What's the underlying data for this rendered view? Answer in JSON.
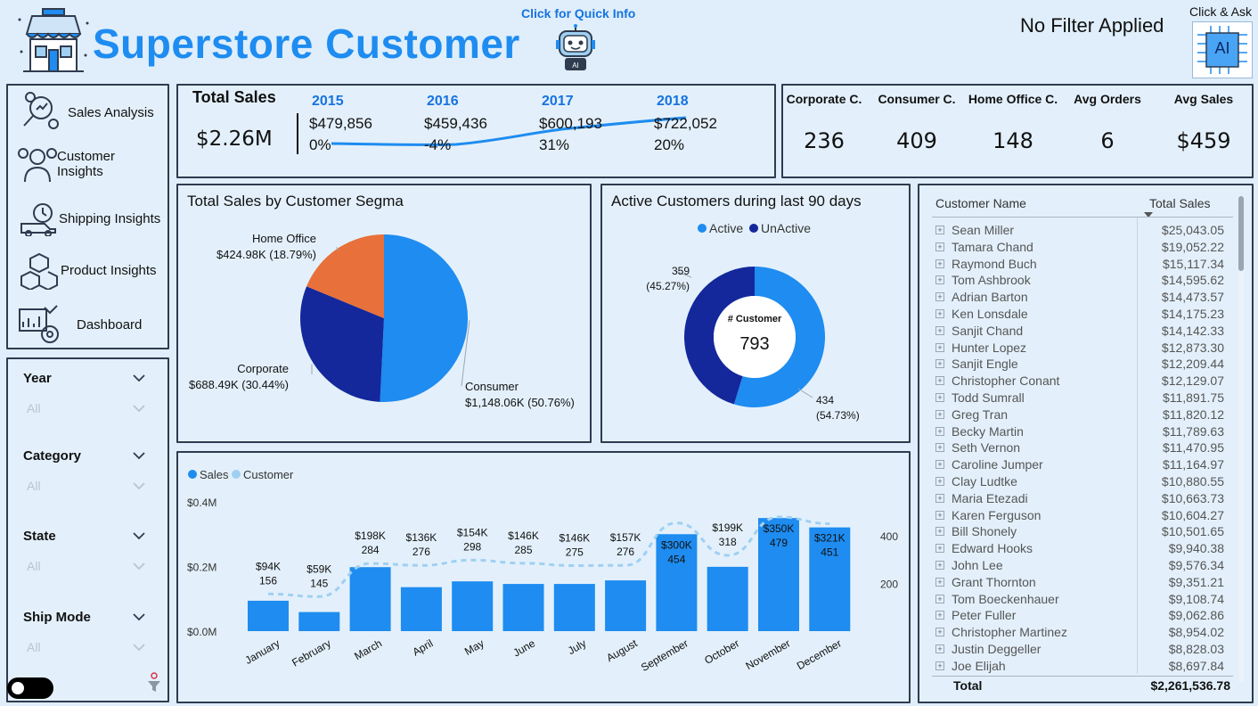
{
  "header": {
    "title": "Superstore Customer",
    "quick_info": "Click for Quick Info",
    "filter_status": "No Filter Applied",
    "click_ask": "Click & Ask",
    "ai_label": "AI"
  },
  "nav": {
    "items": [
      {
        "label": "Sales Analysis",
        "icon": "sales-analysis-icon"
      },
      {
        "label": "Customer Insights",
        "icon": "customer-insights-icon"
      },
      {
        "label": "Shipping Insights",
        "icon": "shipping-icon"
      },
      {
        "label": "Product Insights",
        "icon": "product-icon"
      },
      {
        "label": "Dashboard",
        "icon": "dashboard-icon"
      }
    ]
  },
  "filters": {
    "year": {
      "label": "Year",
      "value": "All"
    },
    "category": {
      "label": "Category",
      "value": "All"
    },
    "state": {
      "label": "State",
      "value": "All"
    },
    "ship_mode": {
      "label": "Ship Mode",
      "value": "All"
    }
  },
  "total_sales": {
    "title": "Total Sales",
    "value": "$2.26M",
    "years": [
      {
        "year": "2015",
        "sales": "$479,856",
        "growth": "0%"
      },
      {
        "year": "2016",
        "sales": "$459,436",
        "growth": "-4%"
      },
      {
        "year": "2017",
        "sales": "$600,193",
        "growth": "31%"
      },
      {
        "year": "2018",
        "sales": "$722,052",
        "growth": "20%"
      }
    ]
  },
  "kpis": [
    {
      "label": "Corporate C.",
      "value": "236"
    },
    {
      "label": "Consumer C.",
      "value": "409"
    },
    {
      "label": "Home Office C.",
      "value": "148"
    },
    {
      "label": "Avg Orders",
      "value": "6"
    },
    {
      "label": "Avg Sales",
      "value": "$459"
    }
  ],
  "colors": {
    "accent": "#1e8cf0",
    "dark_blue": "#14289c",
    "orange": "#e8703a",
    "light_blue": "#9fd0f2",
    "panel_border": "#2f3b4f"
  },
  "chart_data": [
    {
      "type": "pie",
      "title": "Total Sales by Customer Segma",
      "slices": [
        {
          "name": "Consumer",
          "value": 1148.06,
          "label": "$1,148.06K (50.76%)",
          "color": "#1e8cf0"
        },
        {
          "name": "Corporate",
          "value": 688.49,
          "label": "$688.49K (30.44%)",
          "color": "#14289c"
        },
        {
          "name": "Home Office",
          "value": 424.98,
          "label": "$424.98K (18.79%)",
          "color": "#e8703a"
        }
      ]
    },
    {
      "type": "pie",
      "title": "Active Customers during last 90 days",
      "legend": [
        "Active",
        "UnActive"
      ],
      "center_label": "# Customer",
      "center_value": "793",
      "slices": [
        {
          "name": "Active",
          "value": 434,
          "label": "434",
          "pct": "(54.73%)",
          "color": "#1e8cf0"
        },
        {
          "name": "UnActive",
          "value": 359,
          "label": "359",
          "pct": "(45.27%)",
          "color": "#14289c"
        }
      ]
    },
    {
      "type": "bar",
      "legend": [
        "Sales",
        "Customer"
      ],
      "categories": [
        "January",
        "February",
        "March",
        "April",
        "May",
        "June",
        "July",
        "August",
        "September",
        "October",
        "November",
        "December"
      ],
      "series": [
        {
          "name": "Sales",
          "values": [
            94,
            59,
            198,
            136,
            154,
            146,
            146,
            157,
            300,
            199,
            350,
            321
          ],
          "labels": [
            "$94K",
            "$59K",
            "$198K",
            "$136K",
            "$154K",
            "$146K",
            "$146K",
            "$157K",
            "$300K",
            "$199K",
            "$350K",
            "$321K"
          ]
        },
        {
          "name": "Customer",
          "values": [
            156,
            145,
            284,
            276,
            298,
            285,
            275,
            276,
            454,
            318,
            479,
            451
          ],
          "labels": [
            "156",
            "145",
            "284",
            "276",
            "298",
            "285",
            "275",
            "276",
            "454",
            "318",
            "479",
            "451"
          ]
        }
      ],
      "yticks_left": [
        "$0.4M",
        "$0.2M",
        "$0.0M"
      ],
      "yticks_right": [
        "400",
        "200"
      ],
      "ylim": [
        0,
        400
      ],
      "ylim_right": [
        0,
        580
      ]
    }
  ],
  "customer_table": {
    "col_name": "Customer Name",
    "col_sales": "Total Sales",
    "rows": [
      {
        "name": "Sean Miller",
        "sales": "$25,043.05"
      },
      {
        "name": "Tamara Chand",
        "sales": "$19,052.22"
      },
      {
        "name": "Raymond Buch",
        "sales": "$15,117.34"
      },
      {
        "name": "Tom Ashbrook",
        "sales": "$14,595.62"
      },
      {
        "name": "Adrian Barton",
        "sales": "$14,473.57"
      },
      {
        "name": "Ken Lonsdale",
        "sales": "$14,175.23"
      },
      {
        "name": "Sanjit Chand",
        "sales": "$14,142.33"
      },
      {
        "name": "Hunter Lopez",
        "sales": "$12,873.30"
      },
      {
        "name": "Sanjit Engle",
        "sales": "$12,209.44"
      },
      {
        "name": "Christopher Conant",
        "sales": "$12,129.07"
      },
      {
        "name": "Todd Sumrall",
        "sales": "$11,891.75"
      },
      {
        "name": "Greg Tran",
        "sales": "$11,820.12"
      },
      {
        "name": "Becky Martin",
        "sales": "$11,789.63"
      },
      {
        "name": "Seth Vernon",
        "sales": "$11,470.95"
      },
      {
        "name": "Caroline Jumper",
        "sales": "$11,164.97"
      },
      {
        "name": "Clay Ludtke",
        "sales": "$10,880.55"
      },
      {
        "name": "Maria Etezadi",
        "sales": "$10,663.73"
      },
      {
        "name": "Karen Ferguson",
        "sales": "$10,604.27"
      },
      {
        "name": "Bill Shonely",
        "sales": "$10,501.65"
      },
      {
        "name": "Edward Hooks",
        "sales": "$9,940.38"
      },
      {
        "name": "John Lee",
        "sales": "$9,576.34"
      },
      {
        "name": "Grant Thornton",
        "sales": "$9,351.21"
      },
      {
        "name": "Tom Boeckenhauer",
        "sales": "$9,108.74"
      },
      {
        "name": "Peter Fuller",
        "sales": "$9,062.86"
      },
      {
        "name": "Christopher Martinez",
        "sales": "$8,954.02"
      },
      {
        "name": "Justin Deggeller",
        "sales": "$8,828.03"
      },
      {
        "name": "Joe Elijah",
        "sales": "$8,697.84"
      }
    ],
    "total_label": "Total",
    "total_value": "$2,261,536.78"
  }
}
